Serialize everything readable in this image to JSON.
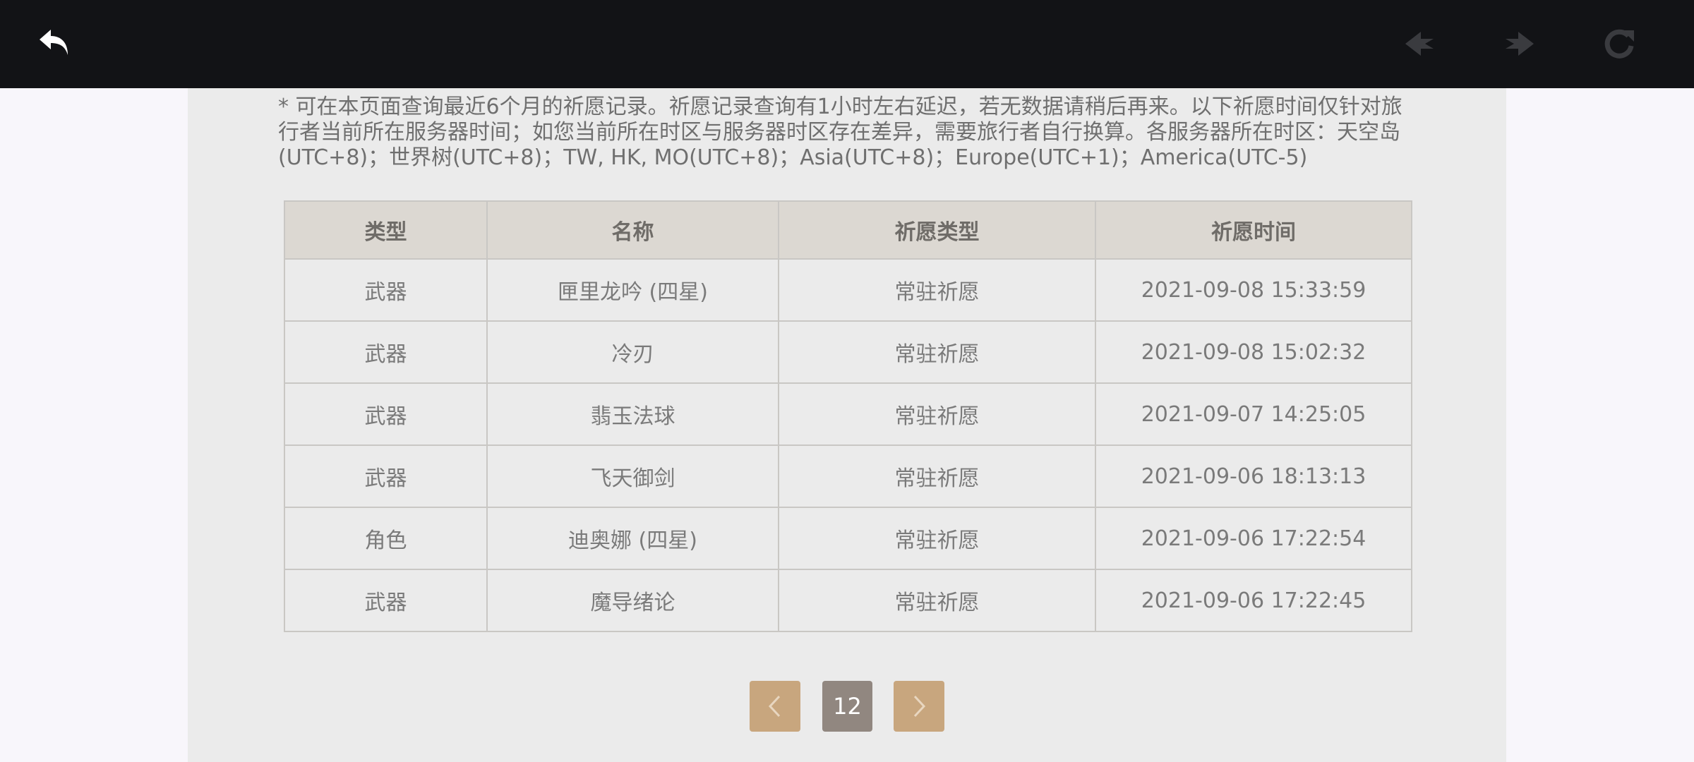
{
  "notice": "* 可在本页面查询最近6个月的祈愿记录。祈愿记录查询有1小时左右延迟，若无数据请稍后再来。以下祈愿时间仅针对旅行者当前所在服务器时间；如您当前所在时区与服务器时区存在差异，需要旅行者自行换算。各服务器所在时区：天空岛(UTC+8)；世界树(UTC+8)；TW, HK, MO(UTC+8)；Asia(UTC+8)；Europe(UTC+1)；America(UTC-5)",
  "table": {
    "headers": [
      "类型",
      "名称",
      "祈愿类型",
      "祈愿时间"
    ],
    "rows": [
      {
        "type": "武器",
        "name": "匣里龙吟 (四星)",
        "wish_type": "常驻祈愿",
        "time": "2021-09-08 15:33:59",
        "rare": true
      },
      {
        "type": "武器",
        "name": "冷刃",
        "wish_type": "常驻祈愿",
        "time": "2021-09-08 15:02:32",
        "rare": false
      },
      {
        "type": "武器",
        "name": "翡玉法球",
        "wish_type": "常驻祈愿",
        "time": "2021-09-07 14:25:05",
        "rare": false
      },
      {
        "type": "武器",
        "name": "飞天御剑",
        "wish_type": "常驻祈愿",
        "time": "2021-09-06 18:13:13",
        "rare": false
      },
      {
        "type": "角色",
        "name": "迪奥娜 (四星)",
        "wish_type": "常驻祈愿",
        "time": "2021-09-06 17:22:54",
        "rare": true
      },
      {
        "type": "武器",
        "name": "魔导绪论",
        "wish_type": "常驻祈愿",
        "time": "2021-09-06 17:22:45",
        "rare": false
      }
    ]
  },
  "pager": {
    "current_page": "12"
  },
  "colors": {
    "rare_name": "#9a4fd0",
    "pager_button": "#c8a67e",
    "pager_current": "#918780"
  },
  "icons": {
    "back": "back-arrow-icon",
    "prev": "nav-back-icon",
    "next": "nav-forward-icon",
    "reload": "reload-icon"
  }
}
